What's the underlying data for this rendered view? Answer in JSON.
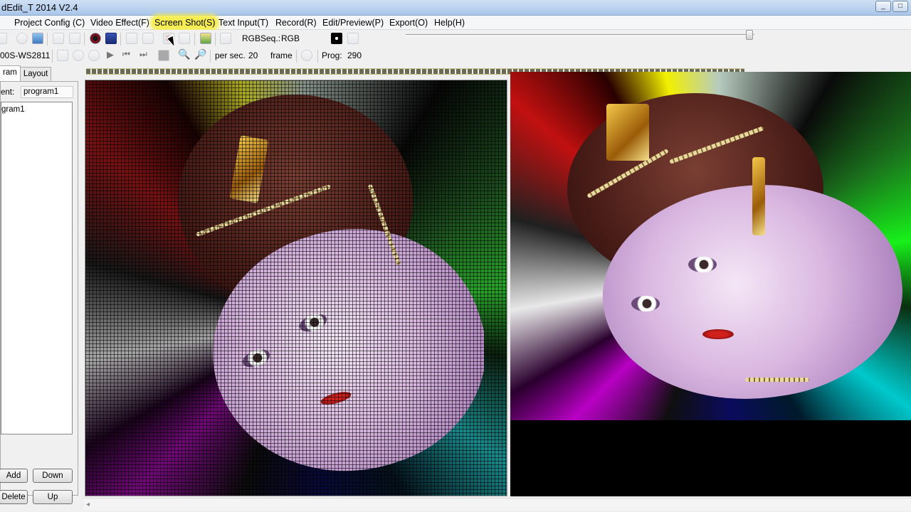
{
  "window": {
    "title": "dEdit_T 2014 V2.4",
    "buttons": [
      "_",
      "□"
    ]
  },
  "menu": [
    {
      "label": "Project Config (C)"
    },
    {
      "label": "Video Effect(F)"
    },
    {
      "label": "Screen Shot(S)",
      "highlighted": true
    },
    {
      "label": "Text Input(T)"
    },
    {
      "label": "Record(R)"
    },
    {
      "label": "Edit/Preview(P)"
    },
    {
      "label": "Export(O)"
    },
    {
      "label": "Help(H)"
    }
  ],
  "toolbar1": {
    "rgbseq_label": "RGBSeq.:",
    "rgbseq_value": "RGB",
    "icons": [
      "open-icon",
      "settings-icon",
      "image-icon",
      "copy-icon",
      "paste-icon",
      "color-circle-icon",
      "screen-icon",
      "capture-icon",
      "screenshot-icon",
      "record-icon",
      "stop-icon",
      "folder-icon",
      "edit-icon",
      "color-swatch-icon",
      "film-icon"
    ]
  },
  "toolbar2": {
    "chip_label": "00S-WS2811",
    "per_sec_label": "per sec.",
    "per_sec_value": "20",
    "frame_label": "frame",
    "prog_label": "Prog:",
    "prog_value": "290",
    "icons": [
      "film-icon",
      "stop-icon",
      "pause-icon",
      "play-icon",
      "prev-icon",
      "next-icon",
      "block-icon",
      "zoom-in-icon",
      "zoom-out-icon",
      "clock-icon"
    ]
  },
  "left_panel": {
    "tabs": [
      "ram",
      "Layout"
    ],
    "current_label": "ent:",
    "current_value": "program1",
    "list_items": [
      "gram1"
    ],
    "buttons": {
      "add": "Add",
      "down": "Down",
      "delete": "Delete",
      "up": "Up"
    }
  },
  "colors": {
    "menu_highlight": "#f6ed52",
    "title_bar": "#b9d1ee"
  }
}
